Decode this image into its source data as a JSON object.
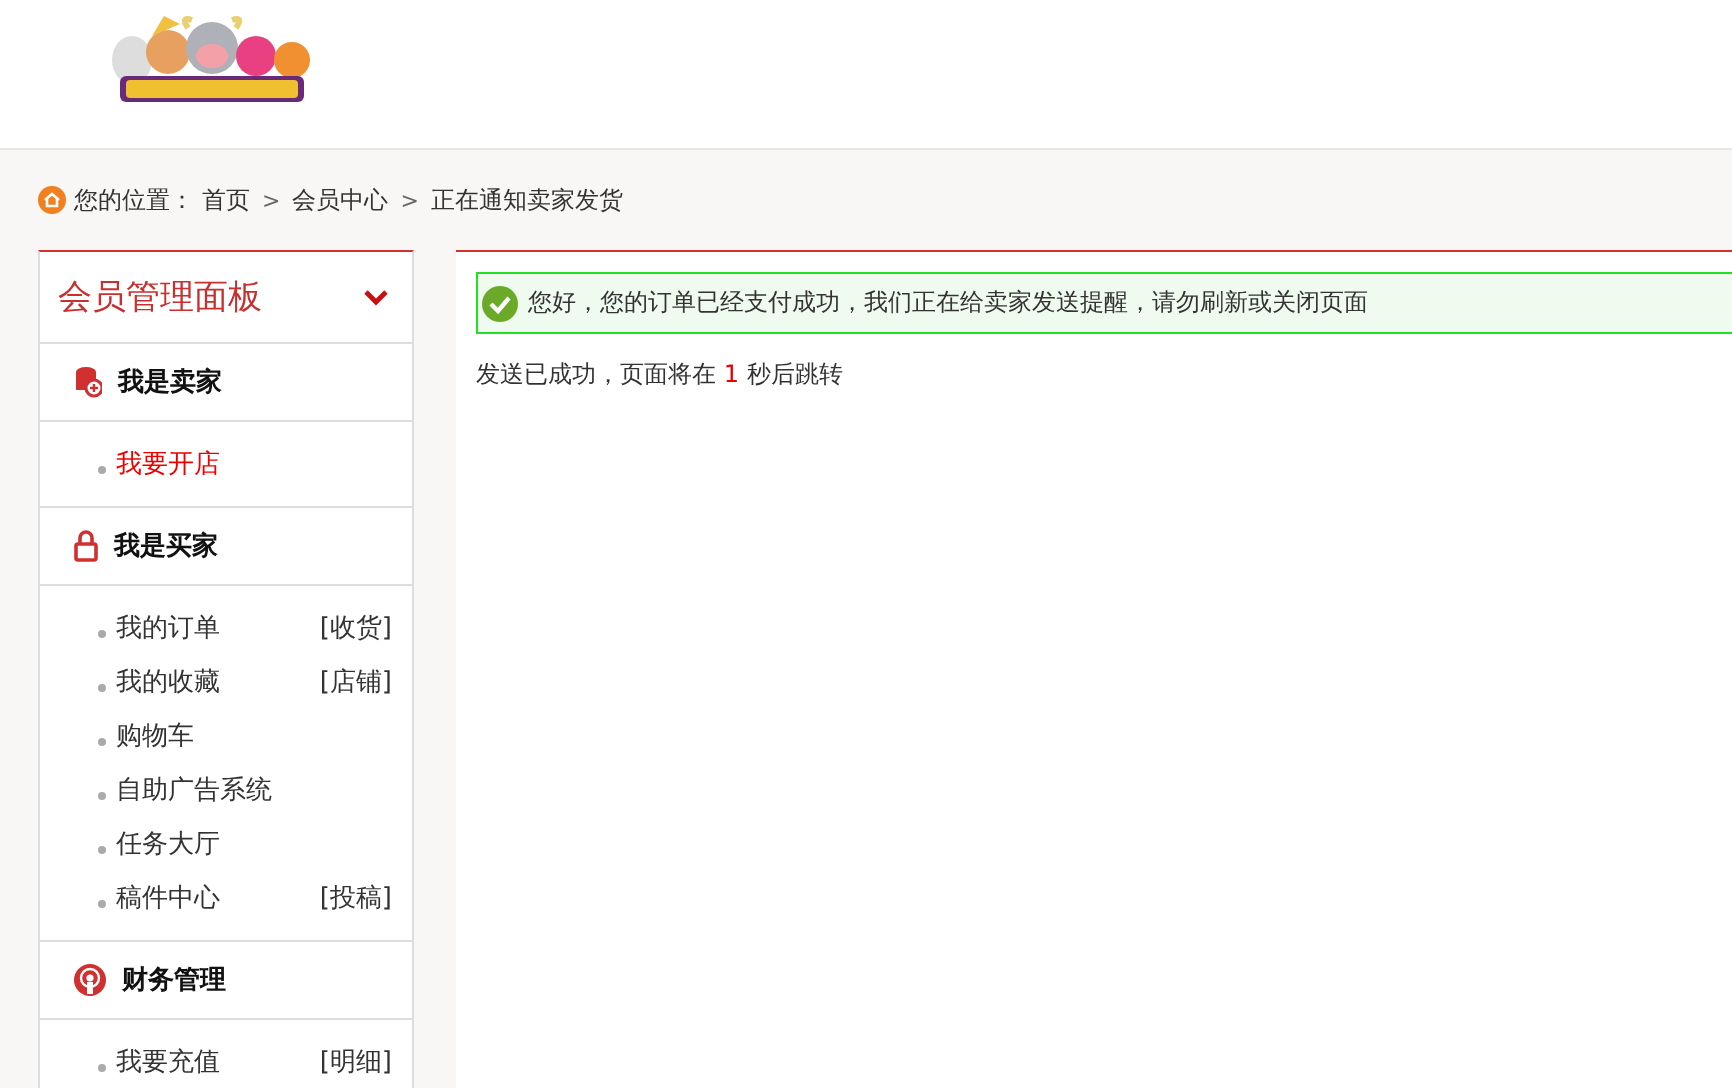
{
  "breadcrumb": {
    "label": "您的位置：",
    "items": [
      "首页",
      "会员中心",
      "正在通知卖家发货"
    ],
    "separator": ">"
  },
  "sidebar": {
    "title": "会员管理面板",
    "expanded": true,
    "sections": [
      {
        "title": "我是卖家",
        "items": [
          {
            "label": "我要开店",
            "selected": true
          }
        ]
      },
      {
        "title": "我是买家",
        "items": [
          {
            "label": "我的订单",
            "selected": false,
            "extra": "[收货]"
          },
          {
            "label": "我的收藏",
            "selected": false,
            "extra": "[店铺]"
          },
          {
            "label": "购物车",
            "selected": false
          },
          {
            "label": "自助广告系统",
            "selected": false
          },
          {
            "label": "任务大厅",
            "selected": false
          },
          {
            "label": "稿件中心",
            "selected": false,
            "extra": "[投稿]"
          }
        ]
      },
      {
        "title": "财务管理",
        "items": [
          {
            "label": "我要充值",
            "selected": false,
            "extra": "[明细]"
          }
        ]
      }
    ]
  },
  "notice": {
    "message": "您好，您的订单已经支付成功，我们正在给卖家发送提醒，请勿刷新或关闭页面"
  },
  "status": {
    "before": "发送已成功，页面将在",
    "count": "1",
    "after": "秒后跳转"
  }
}
